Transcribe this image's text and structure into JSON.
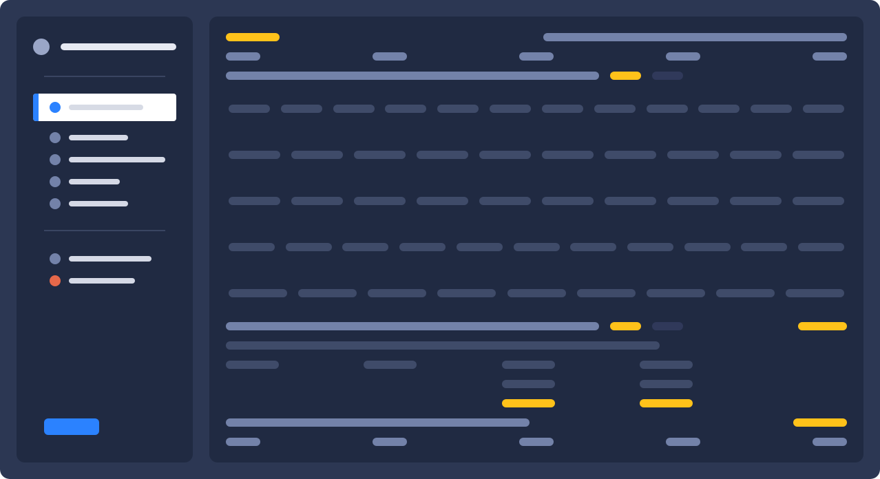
{
  "colors": {
    "frame_bg": "#2c3753",
    "panel_bg": "#202a42",
    "accent_blue": "#2b82ff",
    "accent_yellow": "#ffc21a",
    "danger_red": "#e6684a",
    "muted_slate": "#7382a9"
  },
  "sidebar": {
    "avatar_icon": "avatar-icon",
    "nav_items": [
      {
        "state": "active",
        "icon": "dot-icon"
      },
      {
        "state": "default",
        "icon": "dot-icon"
      },
      {
        "state": "default",
        "icon": "dot-icon"
      },
      {
        "state": "default",
        "icon": "dot-icon"
      },
      {
        "state": "default",
        "icon": "dot-icon"
      }
    ],
    "secondary_items": [
      {
        "state": "default",
        "icon": "dot-icon"
      },
      {
        "state": "alert",
        "icon": "alert-dot-icon"
      }
    ]
  }
}
